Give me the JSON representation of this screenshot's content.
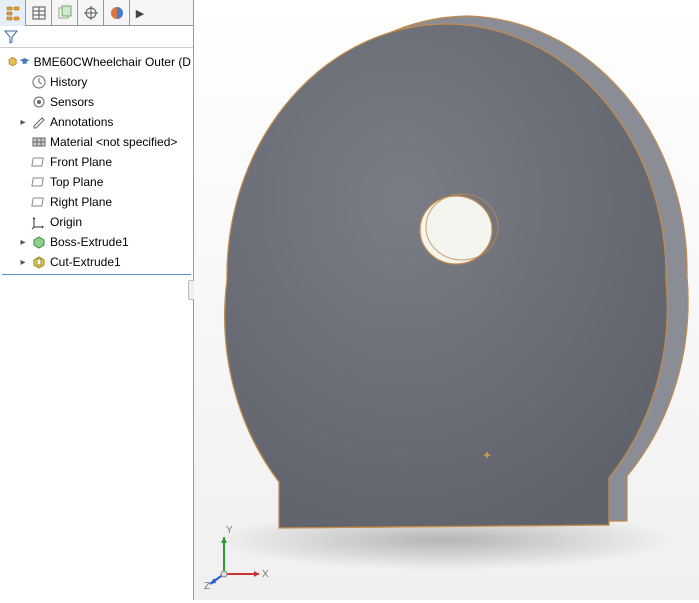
{
  "tabs": [
    {
      "name": "feature-manager",
      "active": true
    },
    {
      "name": "property-manager",
      "active": false
    },
    {
      "name": "configuration-manager",
      "active": false
    },
    {
      "name": "dimxpert-manager",
      "active": false
    },
    {
      "name": "display-manager",
      "active": false
    },
    {
      "name": "more",
      "active": false
    }
  ],
  "tree": {
    "root_label": "BME60CWheelchair Outer  (D",
    "items": [
      {
        "label": "History",
        "icon": "history"
      },
      {
        "label": "Sensors",
        "icon": "sensors"
      },
      {
        "label": "Annotations",
        "icon": "annotations",
        "expandable": true
      },
      {
        "label": "Material <not specified>",
        "icon": "material"
      },
      {
        "label": "Front Plane",
        "icon": "plane"
      },
      {
        "label": "Top Plane",
        "icon": "plane"
      },
      {
        "label": "Right Plane",
        "icon": "plane"
      },
      {
        "label": "Origin",
        "icon": "origin"
      },
      {
        "label": "Boss-Extrude1",
        "icon": "boss-extrude",
        "expandable": true
      },
      {
        "label": "Cut-Extrude1",
        "icon": "cut-extrude",
        "expandable": true
      }
    ]
  },
  "viewport": {
    "part_color": "#6d7079",
    "edge_color": "#c28b4a",
    "triad": {
      "x_label": "X",
      "y_label": "Y",
      "z_label": "Z",
      "x_color": "#c83232",
      "y_color": "#2a9d2a",
      "z_color": "#2a5bd7"
    }
  }
}
